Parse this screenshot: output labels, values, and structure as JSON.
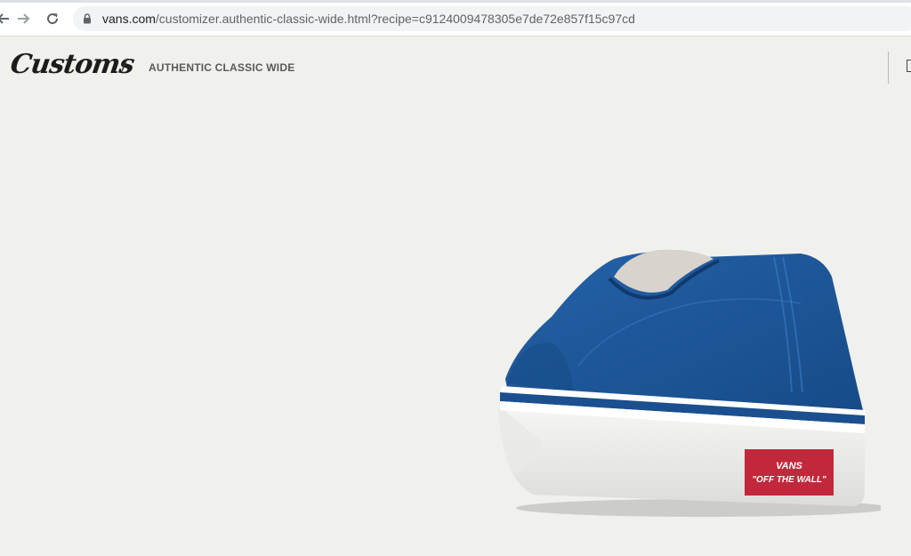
{
  "browser": {
    "url_domain": "vans.com",
    "url_rest": "/customizer.authentic-classic-wide.html?recipe=c9124009478305e7de72e857f15c97cd",
    "icons": [
      "back-arrow-icon",
      "forward-arrow-icon",
      "reload-icon",
      "lock-icon"
    ]
  },
  "header": {
    "logo_text": "Customs",
    "separator": "/",
    "breadcrumb": "AUTHENTIC CLASSIC WIDE"
  },
  "product": {
    "logo_top": "VANS",
    "logo_bottom": "\"OFF THE WALL\"",
    "colors": {
      "upper": "#1d5496",
      "upper_dark": "#123e74",
      "sole": "#f4f4f2",
      "heel_tab": "#c2283c",
      "background": "#f0f0ec"
    }
  }
}
